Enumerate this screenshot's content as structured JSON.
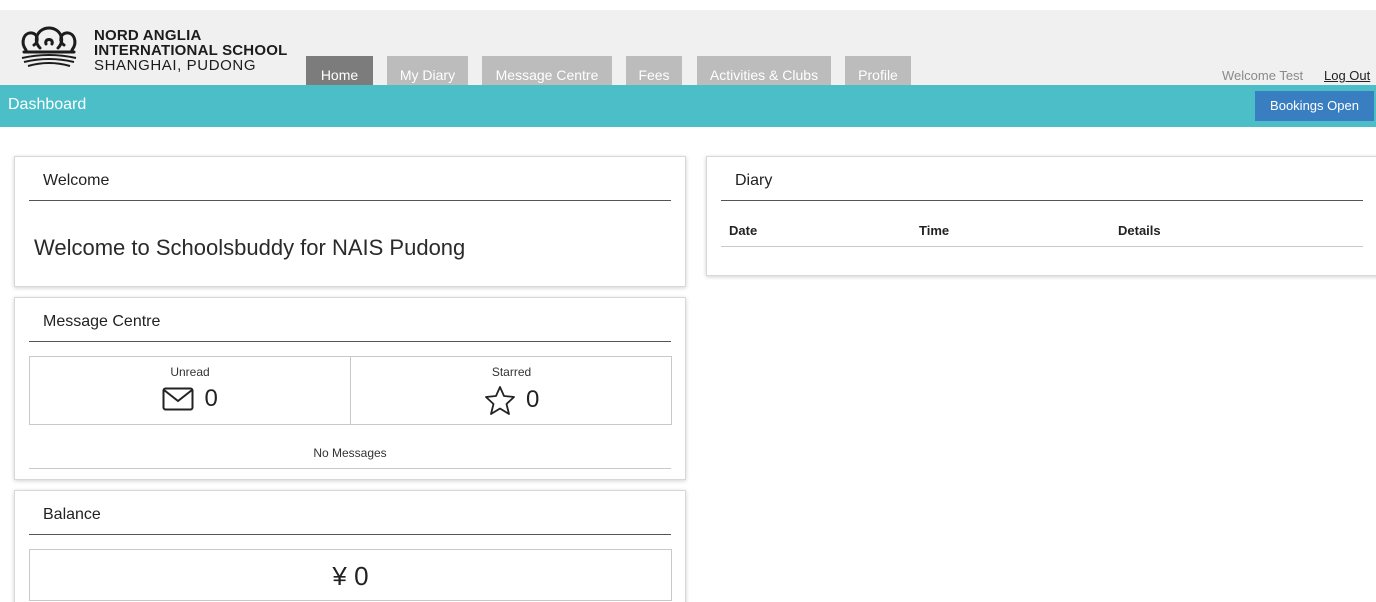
{
  "school": {
    "line1": "NORD ANGLIA",
    "line2": "INTERNATIONAL SCHOOL",
    "line3": "SHANGHAI, PUDONG",
    "logo_icon": "crown-crest-icon"
  },
  "nav": {
    "tabs": [
      {
        "label": "Home",
        "active": true
      },
      {
        "label": "My Diary"
      },
      {
        "label": "Message Centre"
      },
      {
        "label": "Fees"
      },
      {
        "label": "Activities & Clubs"
      },
      {
        "label": "Profile"
      }
    ],
    "welcome_user": "Welcome Test",
    "logout_label": "Log Out"
  },
  "subheader": {
    "title": "Dashboard",
    "bookings_label": "Bookings Open"
  },
  "welcome_panel": {
    "title": "Welcome",
    "text": "Welcome to Schoolsbuddy for NAIS Pudong"
  },
  "message_panel": {
    "title": "Message Centre",
    "unread_label": "Unread",
    "unread_count": "0",
    "unread_icon": "envelope-icon",
    "starred_label": "Starred",
    "starred_count": "0",
    "starred_icon": "star-icon",
    "empty_text": "No Messages"
  },
  "balance_panel": {
    "title": "Balance",
    "value": "¥ 0"
  },
  "diary_panel": {
    "title": "Diary",
    "columns": [
      "Date",
      "Time",
      "Details"
    ]
  },
  "colors": {
    "accent_teal": "#4bbec7",
    "button_blue": "#3a7ec2",
    "tab_active": "#7d7c7c",
    "tab_inactive": "#bdbcbc"
  }
}
